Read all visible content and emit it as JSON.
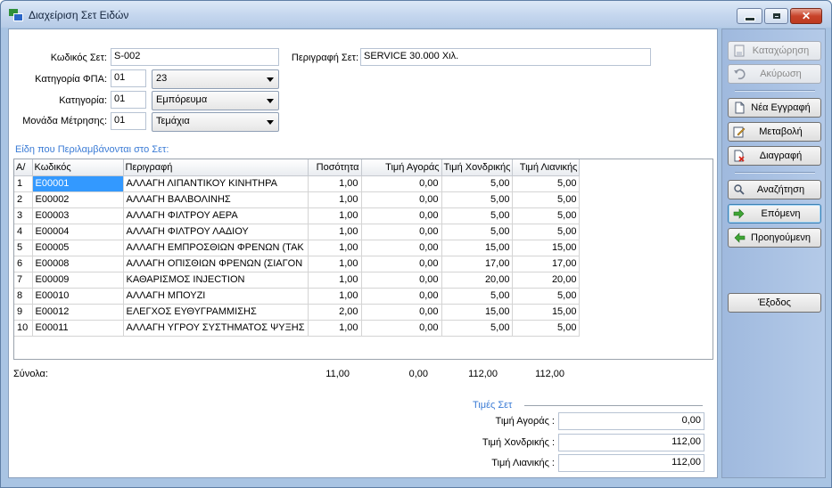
{
  "window": {
    "title": "Διαχείριση Σετ Ειδών"
  },
  "header": {
    "set_code_label": "Κωδικός Σετ:",
    "set_code_value": "S-002",
    "description_label": "Περιγραφή Σετ:",
    "description_value": "SERVICE 30.000 Χιλ.",
    "vat_label": "Κατηγορία ΦΠΑ:",
    "vat_code": "01",
    "vat_value": "23",
    "category_label": "Κατηγορία:",
    "category_code": "01",
    "category_value": "Εμπόρευμα",
    "unit_label": "Μονάδα Μέτρησης:",
    "unit_code": "01",
    "unit_value": "Τεμάχια"
  },
  "items_section_title": "Είδη που Περιλαμβάνονται στο Σετ:",
  "table": {
    "columns": [
      "Α/",
      "Κωδικός",
      "Περιγραφή",
      "Ποσότητα",
      "Τιμή Αγοράς",
      "Τιμή Χονδρικής",
      "Τιμή Λιανικής"
    ],
    "rows": [
      [
        "1",
        "E00001",
        "ΑΛΛΑΓΗ ΛΙΠΑΝΤΙΚΟΥ ΚΙΝΗΤΗΡΑ",
        "1,00",
        "0,00",
        "5,00",
        "5,00"
      ],
      [
        "2",
        "E00002",
        "ΑΛΛΑΓΗ ΒΑΛΒΟΛΙΝΗΣ",
        "1,00",
        "0,00",
        "5,00",
        "5,00"
      ],
      [
        "3",
        "E00003",
        "ΑΛΛΑΓΗ ΦΙΛΤΡΟΥ ΑΕΡΑ",
        "1,00",
        "0,00",
        "5,00",
        "5,00"
      ],
      [
        "4",
        "E00004",
        "ΑΛΛΑΓΗ ΦΙΛΤΡΟΥ ΛΑΔΙΟΥ",
        "1,00",
        "0,00",
        "5,00",
        "5,00"
      ],
      [
        "5",
        "E00005",
        "ΑΛΛΑΓΗ ΕΜΠΡΟΣΘΙΩΝ ΦΡΕΝΩΝ (ΤΑΚ",
        "1,00",
        "0,00",
        "15,00",
        "15,00"
      ],
      [
        "6",
        "E00008",
        "ΑΛΛΑΓΗ ΟΠΙΣΘΙΩΝ ΦΡΕΝΩΝ (ΣΙΑΓΟΝ",
        "1,00",
        "0,00",
        "17,00",
        "17,00"
      ],
      [
        "7",
        "E00009",
        "ΚΑΘΑΡΙΣΜΟΣ INJECTION",
        "1,00",
        "0,00",
        "20,00",
        "20,00"
      ],
      [
        "8",
        "E00010",
        "ΑΛΛΑΓΗ ΜΠΟΥΖΙ",
        "1,00",
        "0,00",
        "5,00",
        "5,00"
      ],
      [
        "9",
        "E00012",
        "ΕΛΕΓΧΟΣ ΕΥΘΥΓΡΑΜΜΙΣΗΣ",
        "2,00",
        "0,00",
        "15,00",
        "15,00"
      ],
      [
        "10",
        "E00011",
        "ΑΛΛΑΓΗ ΥΓΡΟΥ ΣΥΣΤΗΜΑΤΟΣ ΨΥΞΗΣ",
        "1,00",
        "0,00",
        "5,00",
        "5,00"
      ]
    ]
  },
  "totals": {
    "label": "Σύνολα:",
    "quantity": "11,00",
    "purchase": "0,00",
    "wholesale": "112,00",
    "retail": "112,00"
  },
  "set_prices": {
    "title": "Τιμές Σετ",
    "purchase_label": "Τιμή Αγοράς :",
    "purchase_value": "0,00",
    "wholesale_label": "Τιμή Χονδρικής :",
    "wholesale_value": "112,00",
    "retail_label": "Τιμή Λιανικής :",
    "retail_value": "112,00"
  },
  "sidebar": {
    "save": "Καταχώρηση",
    "cancel": "Ακύρωση",
    "new": "Νέα Εγγραφή",
    "edit": "Μεταβολή",
    "delete": "Διαγραφή",
    "search": "Αναζήτηση",
    "next": "Επόμενη",
    "previous": "Προηγούμενη",
    "exit": "Έξοδος"
  },
  "icons": {
    "save": "save-icon",
    "cancel": "undo-icon",
    "new": "new-document-icon",
    "edit": "edit-icon",
    "delete": "delete-icon",
    "search": "search-icon",
    "next": "arrow-right-icon",
    "previous": "arrow-left-icon"
  },
  "colors": {
    "accent": "#3a7bd5",
    "selection": "#3399ff",
    "sidebar": "#a9c4e3",
    "close": "#c8432a"
  }
}
